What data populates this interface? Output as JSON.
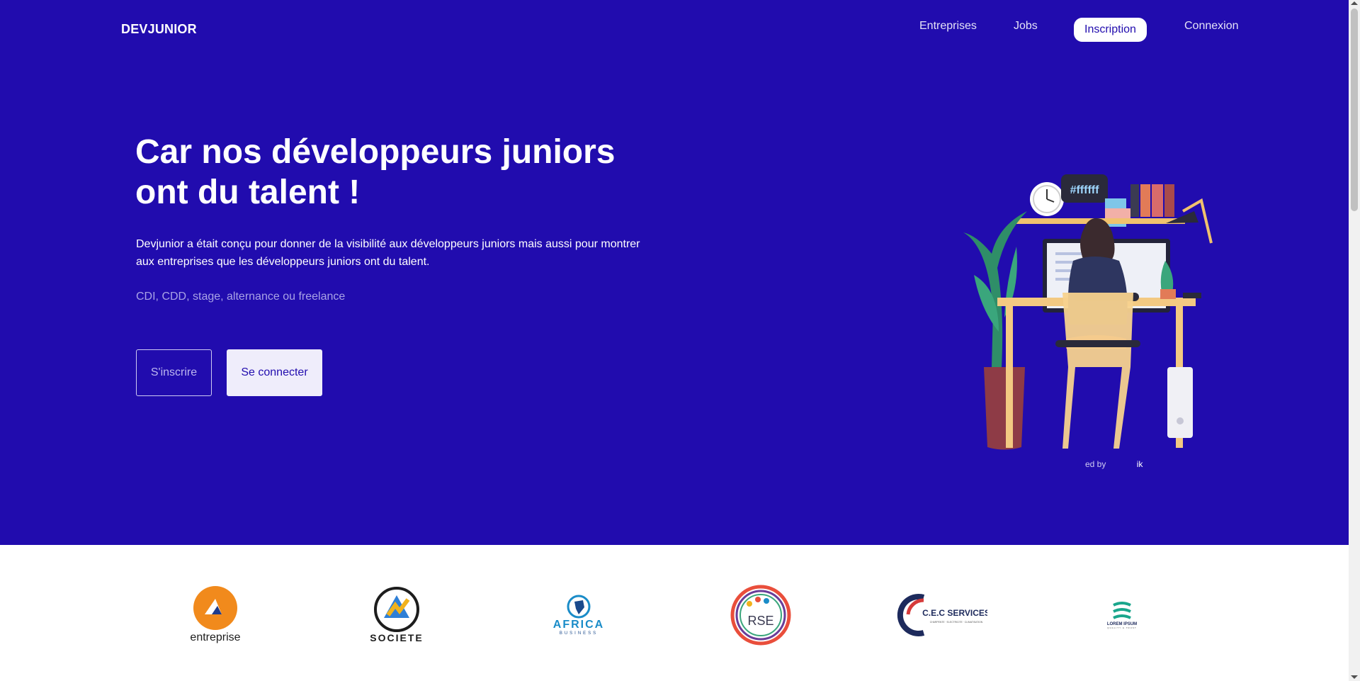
{
  "header": {
    "brand": "DEVJUNIOR",
    "nav": [
      {
        "label": "Entreprises"
      },
      {
        "label": "Jobs"
      },
      {
        "label": "Inscription"
      },
      {
        "label": "Connexion"
      }
    ]
  },
  "hero": {
    "title": "Car nos développeurs juniors ont du talent !",
    "lead": "Devjunior a était conçu pour donner de la visibilité aux développeurs juniors mais aussi pour montrer aux entreprises que les développeurs juniors ont du talent.",
    "sub": "CDI, CDD, stage, alternance ou freelance",
    "buttons": {
      "signup": "S'inscrire",
      "login": "Se connecter"
    },
    "illustration": {
      "screen_tag": "#ffffff"
    },
    "credit": {
      "prefix": "ed by",
      "name": "ik"
    }
  },
  "partners": [
    {
      "name": "entreprise"
    },
    {
      "name": "SOCIETE"
    },
    {
      "name": "AFRICA",
      "tagline": "BUSINESS"
    },
    {
      "name": "RSE"
    },
    {
      "name": "C.E.C SERVICES",
      "tagline": "CHARPENTE · ELECTRICITE · CLIMATISATION"
    },
    {
      "name": "LOREM IPSUM",
      "tagline": "QUALITY & TRUST"
    }
  ],
  "colors": {
    "hero_bg": "#210cae",
    "accent": "#210cae",
    "orange": "#f18a1c",
    "white": "#ffffff"
  }
}
